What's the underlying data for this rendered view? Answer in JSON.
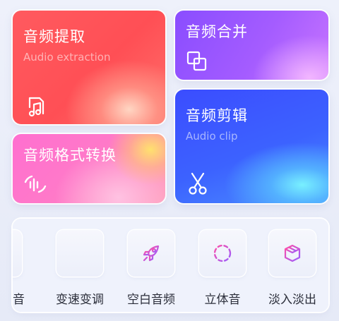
{
  "cards": {
    "extract": {
      "title": "音频提取",
      "subtitle": "Audio extraction",
      "icon": "music-file-icon"
    },
    "merge": {
      "title": "音频合并",
      "icon": "merge-squares-icon"
    },
    "format": {
      "title": "音频格式转换",
      "icon": "waveform-convert-icon"
    },
    "clip": {
      "title": "音频剪辑",
      "subtitle": "Audio clip",
      "icon": "scissors-icon"
    }
  },
  "tools": [
    {
      "label": "音",
      "icon": "waveform-icon"
    },
    {
      "label": "变速变调",
      "icon": "equalizer-sliders-icon"
    },
    {
      "label": "空白音频",
      "icon": "rocket-icon"
    },
    {
      "label": "立体音",
      "icon": "dashed-circle-icon"
    },
    {
      "label": "淡入淡出",
      "icon": "cube-icon"
    }
  ],
  "colors": {
    "extract": "#ff5a5f",
    "merge": "#a45cff",
    "format": "#ff7ac8",
    "clip": "#3c62ff",
    "tool_icon_start": "#ff4fa8",
    "tool_icon_end": "#9a5cff"
  }
}
